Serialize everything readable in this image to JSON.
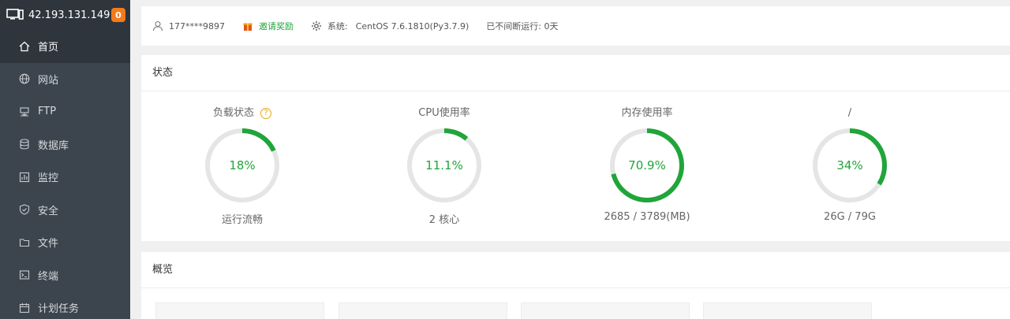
{
  "sidebar": {
    "ip": "42.193.131.149",
    "badge": "0",
    "items": [
      {
        "label": "首页",
        "icon": "home-icon"
      },
      {
        "label": "网站",
        "icon": "globe-icon"
      },
      {
        "label": "FTP",
        "icon": "ftp-icon"
      },
      {
        "label": "数据库",
        "icon": "database-icon"
      },
      {
        "label": "监控",
        "icon": "monitor-chart-icon"
      },
      {
        "label": "安全",
        "icon": "shield-icon"
      },
      {
        "label": "文件",
        "icon": "folder-icon"
      },
      {
        "label": "终端",
        "icon": "terminal-icon"
      },
      {
        "label": "计划任务",
        "icon": "calendar-icon"
      }
    ]
  },
  "topbar": {
    "user": "177****9897",
    "invite": "邀请奖励",
    "system_label": "系统:",
    "system_value": "CentOS 7.6.1810(Py3.7.9)",
    "uptime": "已不间断运行: 0天"
  },
  "status": {
    "title": "状态",
    "gauges": [
      {
        "title": "负载状态",
        "value": "18%",
        "percent": 18,
        "sub": "运行流畅",
        "help": "?"
      },
      {
        "title": "CPU使用率",
        "value": "11.1%",
        "percent": 11.1,
        "sub": "2 核心"
      },
      {
        "title": "内存使用率",
        "value": "70.9%",
        "percent": 70.9,
        "sub": "2685 / 3789(MB)"
      },
      {
        "title": "/",
        "value": "34%",
        "percent": 34,
        "sub": "26G / 79G"
      }
    ]
  },
  "overview": {
    "title": "概览"
  },
  "colors": {
    "accent": "#20a53a",
    "track": "#e5e5e5",
    "sidebar": "#3c444d",
    "badge": "#f37b1d"
  }
}
